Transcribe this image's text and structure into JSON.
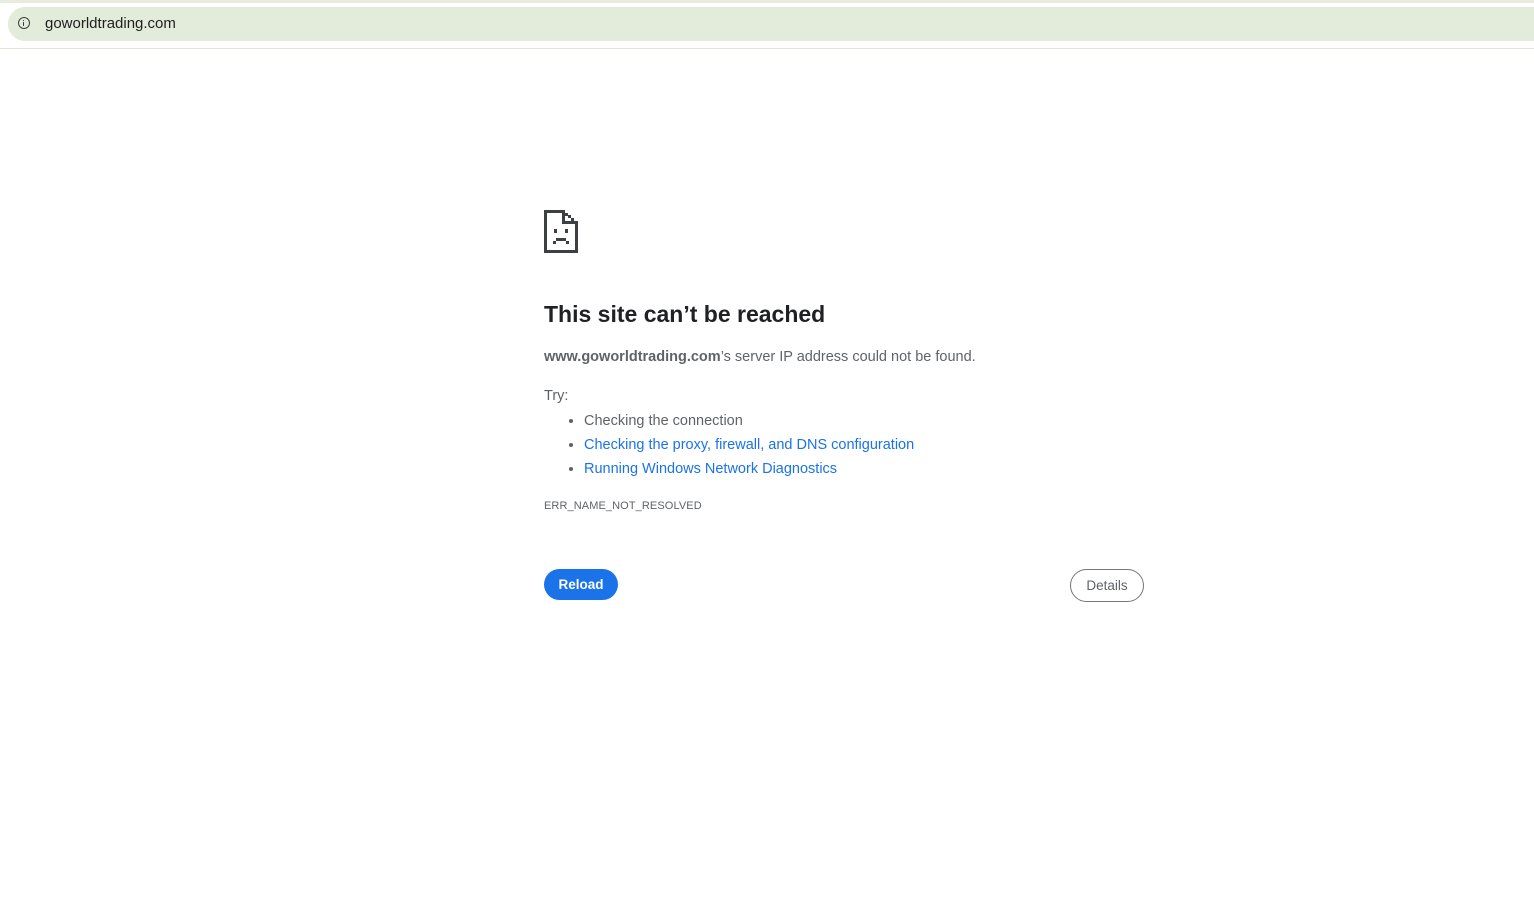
{
  "address_bar": {
    "url": "goworldtrading.com",
    "site_info_icon": "info-icon"
  },
  "error_page": {
    "icon": "sad-page-icon",
    "title": "This site can’t be reached",
    "summary_host": "www.goworldtrading.com",
    "summary_rest": "’s server IP address could not be found.",
    "try_label": "Try:",
    "suggestions": [
      "Checking the connection",
      "Checking the proxy, firewall, and DNS configuration",
      "Running Windows Network Diagnostics"
    ],
    "error_code": "ERR_NAME_NOT_RESOLVED",
    "reload_label": "Reload",
    "details_label": "Details"
  },
  "colors": {
    "omnibox_bg": "#e3ebdb",
    "link": "#1a73e8",
    "primary_button": "#1a73e8",
    "title_text": "#202124",
    "body_text": "#5f6368"
  }
}
